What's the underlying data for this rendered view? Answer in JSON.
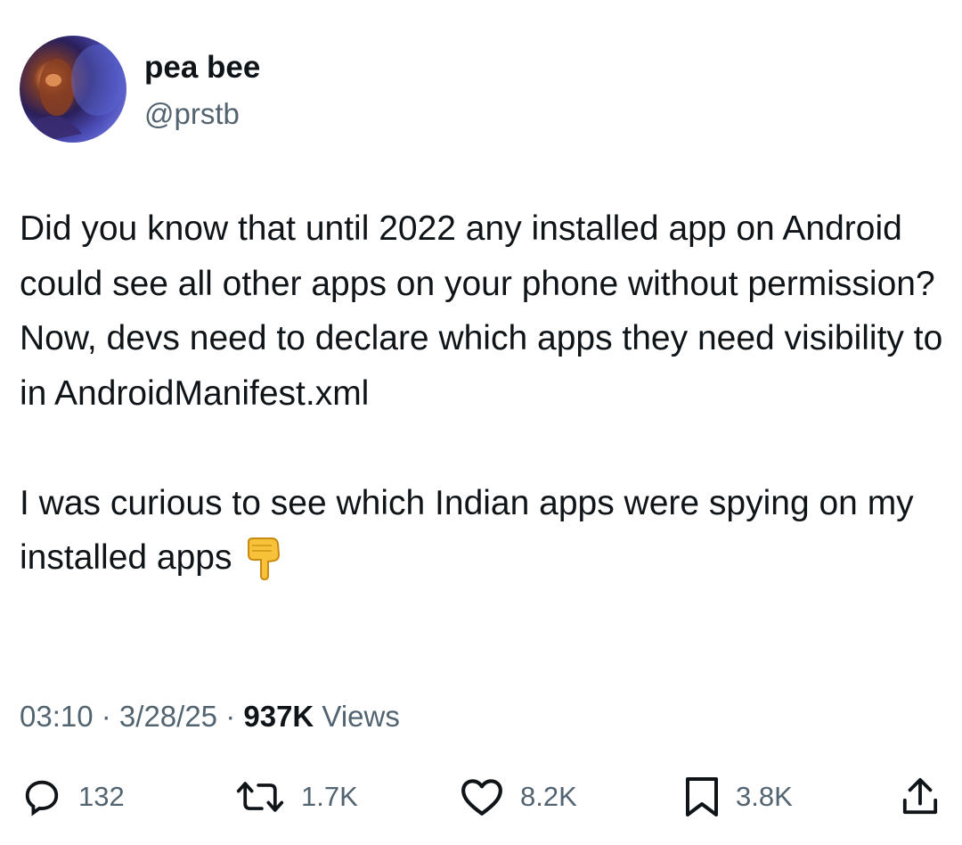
{
  "author": {
    "display_name": "pea bee",
    "handle": "@prstb"
  },
  "tweet": {
    "paragraph_1": "Did you know that until 2022 any installed app on Android could see all other apps on your phone without permission? Now, devs need to declare which apps they need visibility to in AndroidManifest.xml",
    "paragraph_2": "I was curious to see which Indian apps were spying on my installed apps",
    "emoji": "backhand-index-pointing-down"
  },
  "meta": {
    "time": "03:10",
    "separator_1": " · ",
    "date": "3/28/25",
    "separator_2": " · ",
    "views_count": "937K",
    "views_label": " Views"
  },
  "actions": {
    "replies": "132",
    "reposts": "1.7K",
    "likes": "8.2K",
    "bookmarks": "3.8K"
  },
  "colors": {
    "text_primary": "#0f1419",
    "text_secondary": "#536471"
  }
}
